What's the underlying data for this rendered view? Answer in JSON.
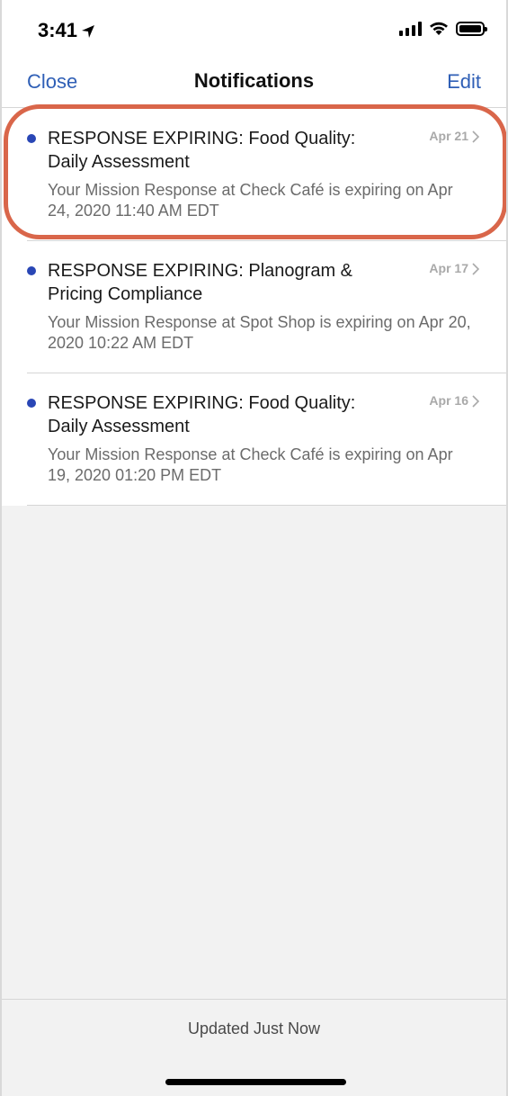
{
  "status_bar": {
    "time": "3:41",
    "icons": [
      "location-arrow-icon",
      "cellular-signal-icon",
      "wifi-icon",
      "battery-icon"
    ]
  },
  "nav": {
    "close_label": "Close",
    "title": "Notifications",
    "edit_label": "Edit"
  },
  "notifications": [
    {
      "title": "RESPONSE EXPIRING: Food Quality: Daily Assessment",
      "body": "Your Mission Response at Check Café is expiring on Apr 24, 2020 11:40 AM EDT",
      "date": "Apr 21",
      "unread": true
    },
    {
      "title": "RESPONSE EXPIRING: Planogram & Pricing Compliance",
      "body": "Your Mission Response at Spot Shop is expiring on Apr 20, 2020 10:22 AM EDT",
      "date": "Apr 17",
      "unread": true
    },
    {
      "title": "RESPONSE EXPIRING: Food Quality: Daily Assessment",
      "body": "Your Mission Response at Check Café is expiring on Apr 19, 2020 01:20 PM EDT",
      "date": "Apr 16",
      "unread": true
    }
  ],
  "footer": {
    "status_text": "Updated Just Now"
  },
  "colors": {
    "accent": "#2f5fb6",
    "unread_dot": "#2946b5",
    "highlight": "#d9664a",
    "background_empty": "#f2f2f2"
  }
}
